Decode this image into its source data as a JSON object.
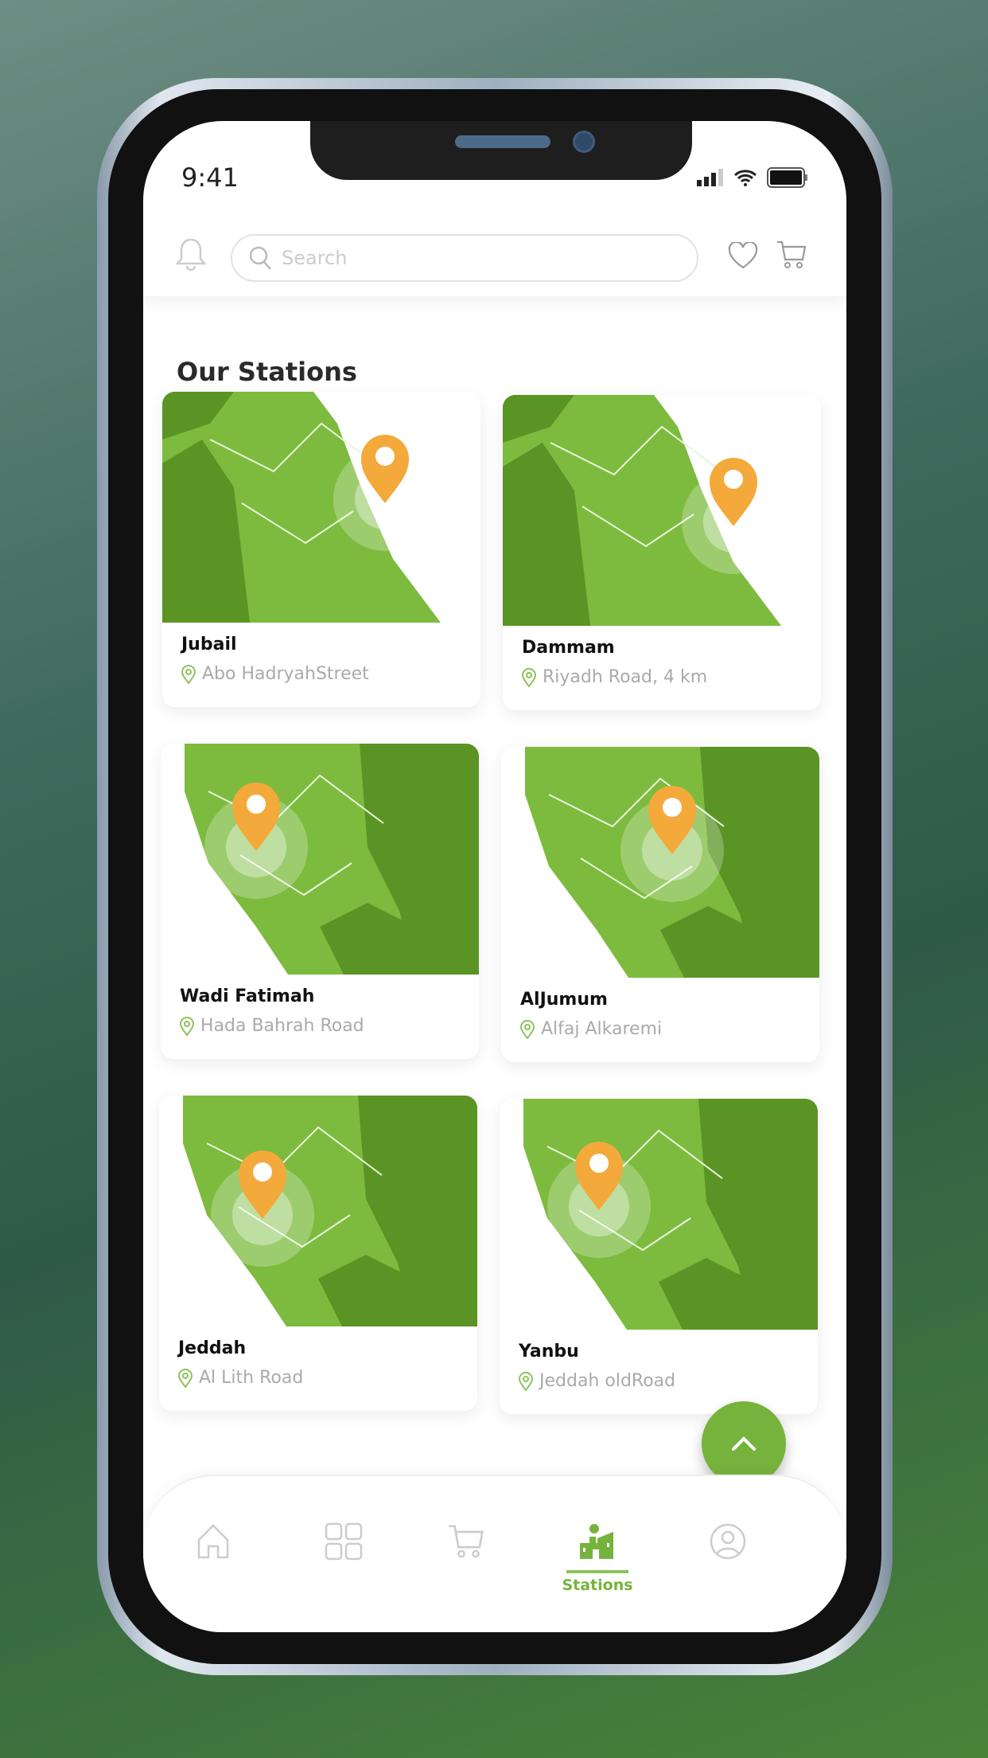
{
  "status_bar": {
    "time": "9:41"
  },
  "header": {
    "search_placeholder": "Search"
  },
  "page_title": "Our Stations",
  "stations": [
    {
      "name": "Jubail",
      "address": "Abo HadryahStreet"
    },
    {
      "name": "Dammam",
      "address": "Riyadh Road, 4 km"
    },
    {
      "name": "Wadi Fatimah",
      "address": "Hada Bahrah Road"
    },
    {
      "name": "AlJumum",
      "address": "Alfaj Alkaremi"
    },
    {
      "name": "Jeddah",
      "address": "Al Lith Road"
    },
    {
      "name": "Yanbu",
      "address": "Jeddah oldRoad"
    }
  ],
  "nav": {
    "items": [
      {
        "icon": "home-icon"
      },
      {
        "icon": "grid-icon"
      },
      {
        "icon": "cart-icon"
      },
      {
        "icon": "stations-icon",
        "label": "Stations",
        "active": true
      },
      {
        "icon": "profile-icon"
      }
    ]
  },
  "colors": {
    "accent": "#76b33c",
    "pin": "#f4a93b",
    "map_light": "#7dbb3f",
    "map_dark": "#5a9424"
  }
}
